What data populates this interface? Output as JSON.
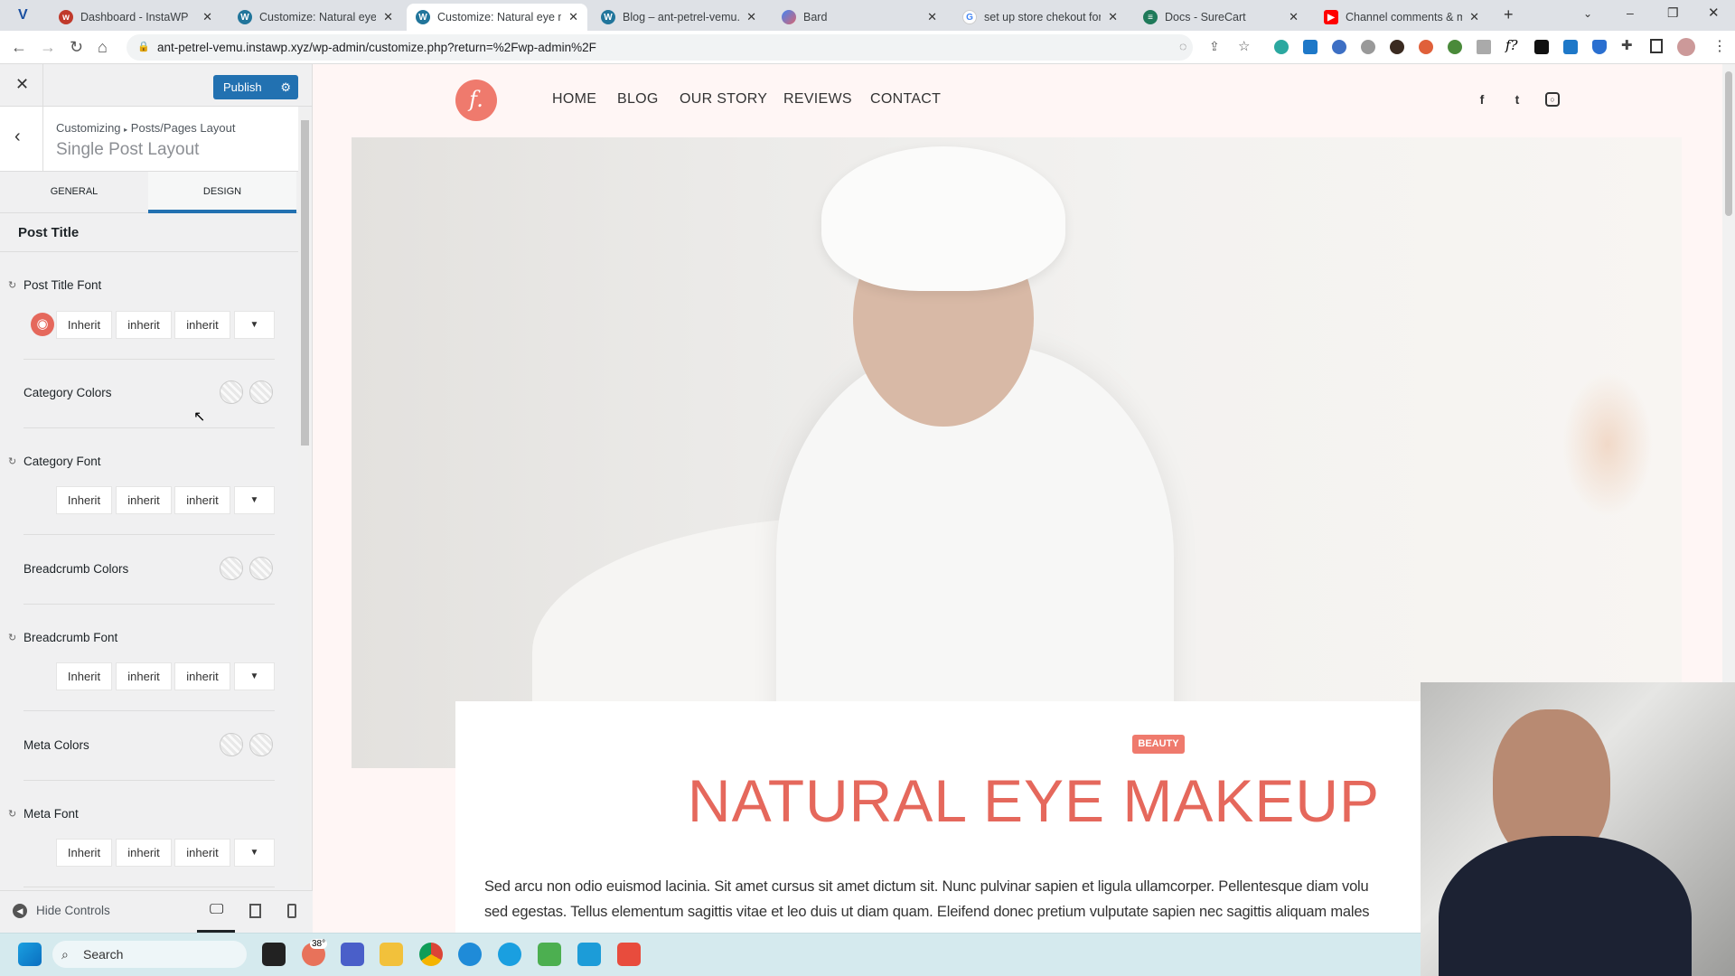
{
  "browser": {
    "tabs": [
      {
        "title": "Dashboard - InstaWP",
        "icon": "instawp-icon"
      },
      {
        "title": "Customize: Natural eye m",
        "icon": "wordpress-icon"
      },
      {
        "title": "Customize: Natural eye m",
        "icon": "wordpress-icon",
        "active": true
      },
      {
        "title": "Blog – ant-petrel-vemu.in",
        "icon": "wordpress-icon"
      },
      {
        "title": "Bard",
        "icon": "bard-icon"
      },
      {
        "title": "set up store chekout form",
        "icon": "google-icon"
      },
      {
        "title": "Docs - SureCart",
        "icon": "surecart-icon"
      },
      {
        "title": "Channel comments & me",
        "icon": "youtube-icon"
      }
    ],
    "url": "ant-petrel-vemu.instawp.xyz/wp-admin/customize.php?return=%2Fwp-admin%2F"
  },
  "customizer": {
    "publish_label": "Publish",
    "breadcrumb_root": "Customizing",
    "breadcrumb_parent": "Posts/Pages Layout",
    "section_title": "Single Post Layout",
    "tabs": [
      "GENERAL",
      "DESIGN"
    ],
    "active_tab": "DESIGN",
    "group_heading": "Post Title",
    "controls": {
      "post_title_font": {
        "label": "Post Title Font",
        "values": [
          "Inherit",
          "inherit",
          "inherit"
        ]
      },
      "category_colors": {
        "label": "Category Colors"
      },
      "category_font": {
        "label": "Category Font",
        "values": [
          "Inherit",
          "inherit",
          "inherit"
        ]
      },
      "breadcrumb_colors": {
        "label": "Breadcrumb Colors"
      },
      "breadcrumb_font": {
        "label": "Breadcrumb Font",
        "values": [
          "Inherit",
          "inherit",
          "inherit"
        ]
      },
      "meta_colors": {
        "label": "Meta Colors"
      },
      "meta_font": {
        "label": "Meta Font",
        "values": [
          "Inherit",
          "inherit",
          "inherit"
        ]
      }
    },
    "hide_controls": "Hide Controls",
    "accent": "#2271b1"
  },
  "site": {
    "logo_letter": "f.",
    "nav": [
      "HOME",
      "BLOG",
      "OUR STORY",
      "REVIEWS",
      "CONTACT"
    ],
    "social": [
      "facebook-icon",
      "twitter-icon",
      "instagram-icon"
    ],
    "category": "BEAUTY",
    "post_title": "NATURAL EYE MAKEUP",
    "paragraph_lines": [
      "Sed arcu non odio euismod lacinia. Sit amet cursus sit amet dictum sit. Nunc pulvinar sapien et ligula ullamcorper. Pellentesque diam volu",
      "sed egestas. Tellus elementum sagittis vitae et leo duis ut diam quam. Eleifend donec pretium vulputate sapien nec sagittis aliquam males"
    ],
    "brand_color": "#e5685c"
  },
  "taskbar": {
    "search_placeholder": "Search",
    "weather": "38°"
  }
}
